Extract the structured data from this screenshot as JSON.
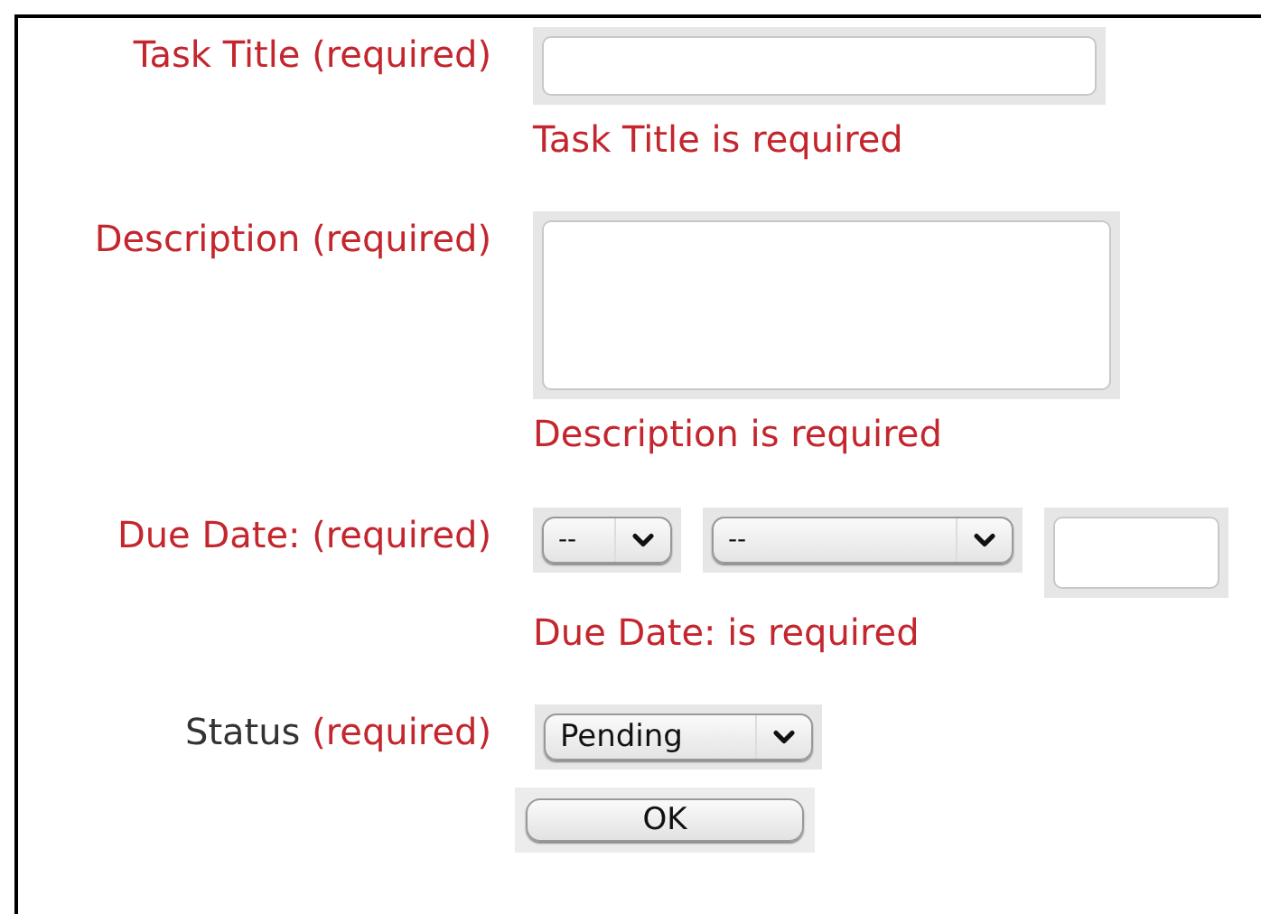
{
  "fields": [
    {
      "kind": "text",
      "label": "Task Title",
      "required_text": "(required)",
      "invalid": true,
      "error": "Task Title is required"
    },
    {
      "kind": "textarea",
      "label": "Description",
      "required_text": "(required)",
      "invalid": true,
      "error": "Description is required"
    },
    {
      "kind": "date",
      "label": "Due Date:",
      "required_text": "(required)",
      "invalid": true,
      "day": "--",
      "month": "--",
      "error": "Due Date: is required"
    },
    {
      "kind": "select",
      "label": "Status",
      "required_text": "(required)",
      "invalid": false,
      "value": "Pending"
    }
  ],
  "submit": {
    "label": "OK"
  }
}
